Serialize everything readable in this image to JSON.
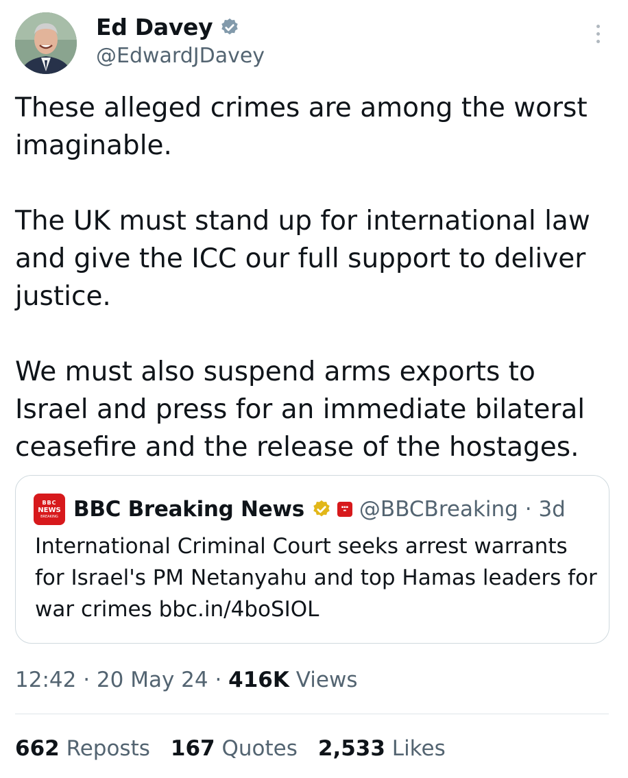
{
  "author": {
    "display_name": "Ed Davey",
    "handle": "@EdwardJDavey",
    "verified_icon": "verified-badge-icon"
  },
  "tweet": {
    "paragraphs": [
      "These alleged crimes are among the worst imaginable.",
      "The UK must stand up for international law and give the ICC our full support to deliver justice.",
      "We must also suspend arms exports to Israel and press for an immediate bilateral ceasefire and the release of the hostages."
    ]
  },
  "quote": {
    "logo_lines": [
      "BBC",
      "NEWS",
      "BREAKING"
    ],
    "display_name": "BBC Breaking News",
    "handle": "@BBCBreaking",
    "separator": "·",
    "age": "3d",
    "text": "International Criminal Court seeks arrest warrants for Israel's PM Netanyahu and top Hamas leaders for war crimes bbc.in/4boSIOL"
  },
  "meta": {
    "time": "12:42",
    "sep1": " · ",
    "date": "20 May 24",
    "sep2": " · ",
    "views_count": "416K",
    "views_label": " Views"
  },
  "stats": {
    "reposts_count": "662",
    "reposts_label": " Reposts",
    "quotes_count": "167",
    "quotes_label": " Quotes",
    "likes_count": "2,533",
    "likes_label": " Likes"
  },
  "colors": {
    "text": "#0f1419",
    "secondary": "#536471",
    "verified_blue": "#829aab",
    "gold": "#e2b719",
    "bbc_red": "#d7191c",
    "border": "#cfd9de"
  }
}
